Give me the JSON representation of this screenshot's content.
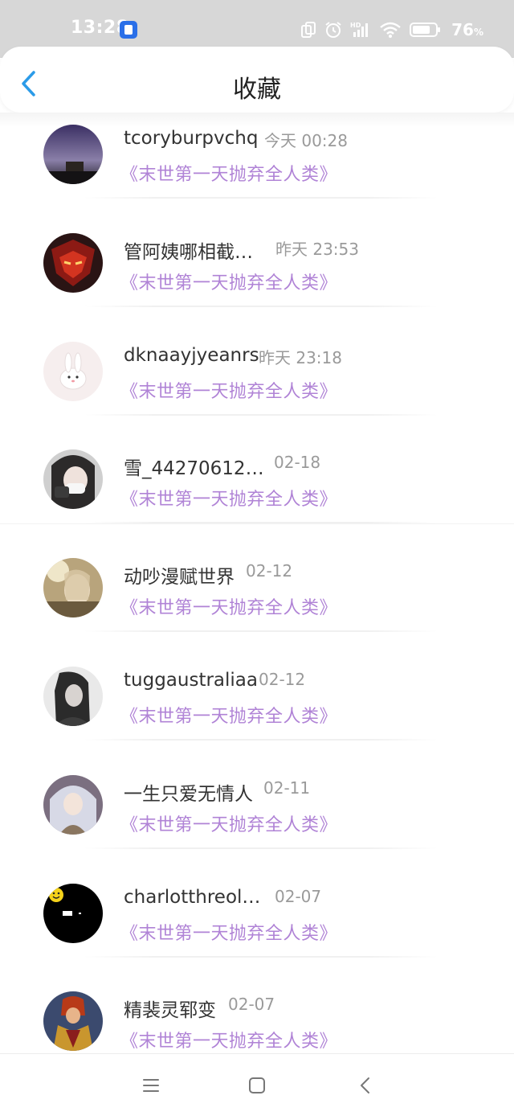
{
  "status_bar": {
    "time": "13:28",
    "battery_percent": "76",
    "battery_unit": "%",
    "icons": [
      "app-notification-icon",
      "screen-rotate-icon",
      "alarm-icon",
      "hd-signal-icon",
      "wifi-icon",
      "battery-icon"
    ]
  },
  "header": {
    "title": "收藏",
    "back_icon": "chevron-left-icon"
  },
  "colors": {
    "book_title": "#b083d6",
    "back_accent": "#2b9be8",
    "status_bar_bg": "#d7d7d7"
  },
  "favorites": [
    {
      "name": "tcoryburpvchq",
      "time": "今天 00:28",
      "book": "《末世第一天抛弃全人类》"
    },
    {
      "name": "管阿姨哪相截…",
      "time": "昨天 23:53",
      "book": "《末世第一天抛弃全人类》"
    },
    {
      "name": "dknaayjyeanrs",
      "time": "昨天 23:18",
      "book": "《末世第一天抛弃全人类》"
    },
    {
      "name": "雪_44270612…",
      "time": "02-18",
      "book": "《末世第一天抛弃全人类》"
    },
    {
      "name": "动吵漫赋世界",
      "time": "02-12",
      "book": "《末世第一天抛弃全人类》"
    },
    {
      "name": "tuggaustraliaa",
      "time": "02-12",
      "book": "《末世第一天抛弃全人类》"
    },
    {
      "name": "一生只爱无情人",
      "time": "02-11",
      "book": "《末世第一天抛弃全人类》"
    },
    {
      "name": "charlotthreol…",
      "time": "02-07",
      "book": "《末世第一天抛弃全人类》"
    },
    {
      "name": "精裴灵郓变",
      "time": "02-07",
      "book": "《末世第一天抛弃全人类》"
    }
  ],
  "nav_bar": {
    "icons": [
      "menu-icon",
      "home-square-icon",
      "back-triangle-icon"
    ]
  }
}
